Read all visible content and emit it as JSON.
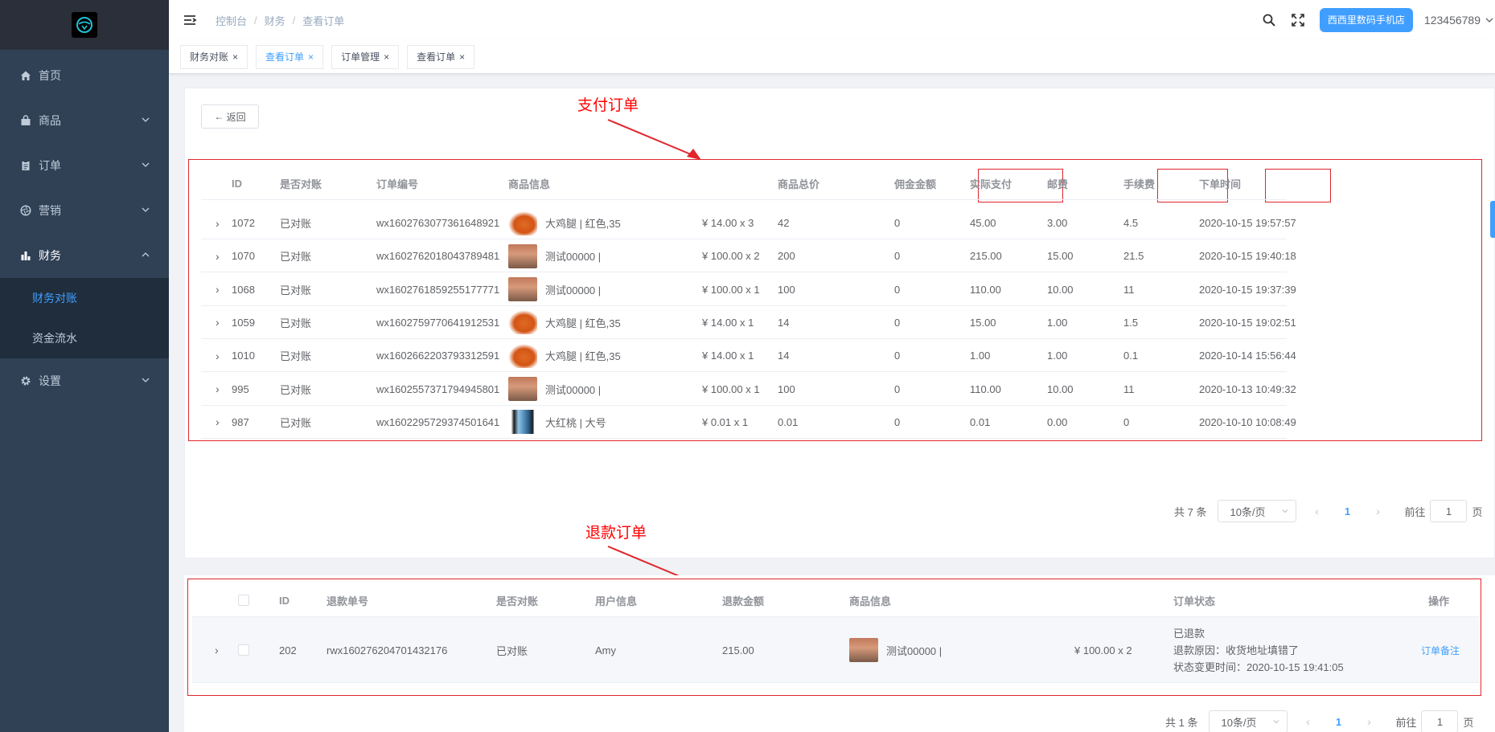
{
  "sidebar": {
    "items": [
      {
        "label": "首页",
        "icon": "home-icon"
      },
      {
        "label": "商品",
        "icon": "bag-icon"
      },
      {
        "label": "订单",
        "icon": "clipboard-icon"
      },
      {
        "label": "营销",
        "icon": "aperture-icon"
      },
      {
        "label": "财务",
        "icon": "bar-chart-icon"
      },
      {
        "label": "设置",
        "icon": "gear-icon"
      }
    ],
    "finance_sub": [
      "财务对账",
      "资金流水"
    ]
  },
  "navbar": {
    "breadcrumb": [
      "控制台",
      "财务",
      "查看订单"
    ],
    "shop": "西西里数码手机店",
    "user": "123456789"
  },
  "tags": [
    {
      "label": "财务对账",
      "active": false
    },
    {
      "label": "查看订单",
      "active": true
    },
    {
      "label": "订单管理",
      "active": false
    },
    {
      "label": "查看订单",
      "active": false
    }
  ],
  "back_label": "返回",
  "annotations": {
    "pay": "支付订单",
    "refund": "退款订单"
  },
  "pay_table": {
    "headers": [
      "ID",
      "是否对账",
      "订单编号",
      "商品信息",
      "商品总价",
      "佣金金额",
      "实际支付",
      "邮费",
      "手续费",
      "下单时间"
    ],
    "rows": [
      {
        "id": "1072",
        "status": "已对账",
        "order_no": "wx1602763077361648921",
        "img": "chicken",
        "product": "大鸡腿 | 红色,35",
        "price": "¥ 14.00 x 3",
        "total": "42",
        "commission": "0",
        "paid": "45.00",
        "postage": "3.00",
        "fee": "4.5",
        "time": "2020-10-15 19:57:57"
      },
      {
        "id": "1070",
        "status": "已对账",
        "order_no": "wx1602762018043789481",
        "img": "kid",
        "product": "测试00000 |",
        "price": "¥ 100.00 x 2",
        "total": "200",
        "commission": "0",
        "paid": "215.00",
        "postage": "15.00",
        "fee": "21.5",
        "time": "2020-10-15 19:40:18"
      },
      {
        "id": "1068",
        "status": "已对账",
        "order_no": "wx1602761859255177771",
        "img": "kid",
        "product": "测试00000 |",
        "price": "¥ 100.00 x 1",
        "total": "100",
        "commission": "0",
        "paid": "110.00",
        "postage": "10.00",
        "fee": "11",
        "time": "2020-10-15 19:37:39"
      },
      {
        "id": "1059",
        "status": "已对账",
        "order_no": "wx1602759770641912531",
        "img": "chicken",
        "product": "大鸡腿 | 红色,35",
        "price": "¥ 14.00 x 1",
        "total": "14",
        "commission": "0",
        "paid": "15.00",
        "postage": "1.00",
        "fee": "1.5",
        "time": "2020-10-15 19:02:51"
      },
      {
        "id": "1010",
        "status": "已对账",
        "order_no": "wx1602662203793312591",
        "img": "chicken",
        "product": "大鸡腿 | 红色,35",
        "price": "¥ 14.00 x 1",
        "total": "14",
        "commission": "0",
        "paid": "1.00",
        "postage": "1.00",
        "fee": "0.1",
        "time": "2020-10-14 15:56:44"
      },
      {
        "id": "995",
        "status": "已对账",
        "order_no": "wx1602557371794945801",
        "img": "kid",
        "product": "测试00000 |",
        "price": "¥ 100.00 x 1",
        "total": "100",
        "commission": "0",
        "paid": "110.00",
        "postage": "10.00",
        "fee": "11",
        "time": "2020-10-13 10:49:32"
      },
      {
        "id": "987",
        "status": "已对账",
        "order_no": "wx1602295729374501641",
        "img": "phone",
        "product": "大红桃 | 大号",
        "price": "¥ 0.01 x 1",
        "total": "0.01",
        "commission": "0",
        "paid": "0.01",
        "postage": "0.00",
        "fee": "0",
        "time": "2020-10-10 10:08:49"
      }
    ]
  },
  "pager1": {
    "total": "共 7 条",
    "size": "10条/页",
    "page": "1",
    "goto": "前往",
    "goto_value": "1",
    "unit": "页"
  },
  "refund_table": {
    "headers": [
      "ID",
      "退款单号",
      "是否对账",
      "用户信息",
      "退款金额",
      "商品信息",
      "订单状态",
      "操作"
    ],
    "rows": [
      {
        "id": "202",
        "refund_no": "rwx160276204701432176",
        "status": "已对账",
        "user": "Amy",
        "amount": "215.00",
        "product": "测试00000 |",
        "price": "¥ 100.00 x 2",
        "state": "已退款",
        "reason": "退款原因：收货地址填错了",
        "changed": "状态变更时间：2020-10-15 19:41:05",
        "action": "订单备注"
      }
    ]
  },
  "pager2": {
    "total": "共 1 条",
    "size": "10条/页",
    "page": "1",
    "goto": "前往",
    "goto_value": "1",
    "unit": "页"
  }
}
